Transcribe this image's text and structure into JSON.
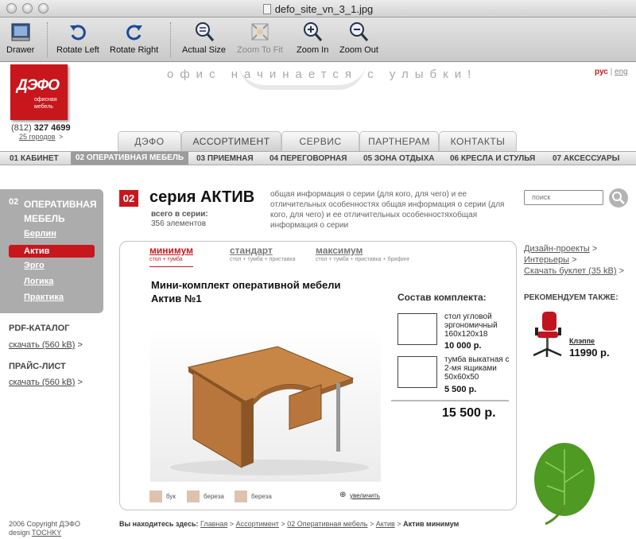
{
  "window": {
    "title": "defo_site_vn_3_1.jpg"
  },
  "toolbar": {
    "buttons": [
      {
        "label": "Drawer",
        "icon": "drawer-icon",
        "enabled": true
      },
      {
        "label": "Rotate Left",
        "icon": "rotate-left-icon",
        "enabled": true
      },
      {
        "label": "Rotate Right",
        "icon": "rotate-right-icon",
        "enabled": true
      },
      {
        "label": "Actual Size",
        "icon": "magnifier-icon",
        "enabled": true
      },
      {
        "label": "Zoom To Fit",
        "icon": "zoom-to-fit-icon",
        "enabled": false
      },
      {
        "label": "Zoom In",
        "icon": "zoom-in-icon",
        "enabled": true
      },
      {
        "label": "Zoom Out",
        "icon": "zoom-out-icon",
        "enabled": true
      }
    ]
  },
  "site": {
    "logo": {
      "text": "ДЭФО",
      "subtext": "офисная мебель"
    },
    "slogan": "офис начинается с улыбки!",
    "lang": {
      "ru": "рус",
      "sep": "|",
      "en": "eng"
    },
    "phone": {
      "code": "(812)",
      "number": "327 4699"
    },
    "cities": {
      "label": "25 городов",
      "arrow": ">"
    },
    "tabs": [
      "ДЭФО",
      "АССОРТИМЕНТ",
      "СЕРВИС",
      "ПАРТНЕРАМ",
      "КОНТАКТЫ"
    ],
    "subnav": [
      "01 КАБИНЕТ",
      "02 ОПЕРАТИВНАЯ МЕБЕЛЬ",
      "03 ПРИЕМНАЯ",
      "04 ПЕРЕГОВОРНАЯ",
      "05 ЗОНА ОТДЫХА",
      "06 КРЕСЛА И СТУЛЬЯ",
      "07 АКСЕССУАРЫ"
    ]
  },
  "sidebar": {
    "num": "02",
    "title": "ОПЕРАТИВНАЯ МЕБЕЛЬ",
    "items": [
      "Берлин",
      "Актив",
      "Эрго",
      "Логика",
      "Практика"
    ],
    "pdf": {
      "heading": "PDF-КАТАЛОГ",
      "link": "скачать (560 kB)",
      "arrow": ">"
    },
    "price": {
      "heading": "ПРАЙС-ЛИСТ",
      "link": "скачать (560 kB)",
      "arrow": ">"
    },
    "copyright": {
      "line1": "2006 Copyright ДЭФО",
      "design": "design",
      "author": "TOCHKY"
    }
  },
  "series": {
    "num": "02",
    "title": "серия АКТИВ",
    "count_label": "всего в серии",
    "count_colon": ":",
    "count": "356 элементов",
    "desc": "общая информация о серии (для кого, для чего) и ее отличительных особенностях общая информация о серии (для кого, для чего) и ее отличительных особенностяхобщая информация о серии"
  },
  "search": {
    "placeholder": "поиск"
  },
  "options": [
    {
      "title": "минимум",
      "sub": "стол + тумба"
    },
    {
      "title": "стандарт",
      "sub": "стол + тумба + приставка"
    },
    {
      "title": "максимум",
      "sub": "стол + тумба + приставка + брифинг"
    }
  ],
  "kit": {
    "title": "Мини-комплект оперативной мебели Актив №1",
    "swatches": [
      "бук",
      "береза",
      "береза"
    ],
    "zoom": "увеличить",
    "comp_title": "Состав комплекта:",
    "components": [
      {
        "name": "стол угловой эргономичный 160x120x18",
        "price": "10 000 р."
      },
      {
        "name": "тумба выкатная с 2-мя ящиками 50x60x50",
        "price": "5 500 р."
      }
    ],
    "total": "15 500 р."
  },
  "right": {
    "links": [
      {
        "text": "Дизайн-проекты",
        "arrow": ">"
      },
      {
        "text": "Интерьеры",
        "arrow": ">"
      },
      {
        "text": "Скачать буклет (35 kB)",
        "arrow": ">"
      }
    ],
    "reco_title": "РЕКОМЕНДУЕМ ТАКЖЕ:",
    "reco": {
      "name": "Клэппе",
      "price": "11990 р."
    }
  },
  "breadcrumbs": {
    "label": "Вы находитесь здесь:",
    "items": [
      "Главная",
      "Ассортимент",
      "02 Оперативная мебель",
      "Актив"
    ],
    "sep": ">",
    "current": "Актив минимум"
  }
}
